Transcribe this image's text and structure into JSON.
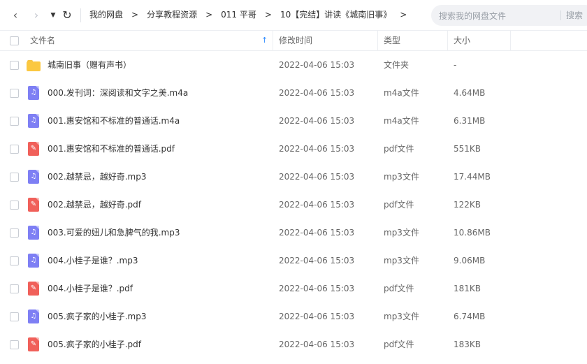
{
  "toolbar": {
    "back_glyph": "‹",
    "forward_glyph": "›",
    "dropdown_glyph": "▼",
    "refresh_glyph": "↻"
  },
  "breadcrumbs": [
    "我的网盘",
    "分享教程资源",
    "011 平哥",
    "10【完结】讲读《城南旧事》"
  ],
  "breadcrumb_sep": ">",
  "search": {
    "placeholder": "搜索我的网盘文件",
    "button": "搜索"
  },
  "columns": {
    "name": "文件名",
    "modified": "修改时间",
    "type": "类型",
    "size": "大小",
    "sort_glyph": "↑"
  },
  "icons": {
    "folder": "folder-icon",
    "audio": "audio-file-icon",
    "pdf": "pdf-file-icon"
  },
  "files": [
    {
      "icon": "folder",
      "name": "城南旧事（赠有声书）",
      "modified": "2022-04-06 15:03",
      "type": "文件夹",
      "size": "-"
    },
    {
      "icon": "audio",
      "name": "000.发刊词：深阅读和文字之美.m4a",
      "modified": "2022-04-06 15:03",
      "type": "m4a文件",
      "size": "4.64MB"
    },
    {
      "icon": "audio",
      "name": "001.惠安馆和不标准的普通话.m4a",
      "modified": "2022-04-06 15:03",
      "type": "m4a文件",
      "size": "6.31MB"
    },
    {
      "icon": "pdf",
      "name": "001.惠安馆和不标准的普通话.pdf",
      "modified": "2022-04-06 15:03",
      "type": "pdf文件",
      "size": "551KB"
    },
    {
      "icon": "audio",
      "name": "002.越禁忌，越好奇.mp3",
      "modified": "2022-04-06 15:03",
      "type": "mp3文件",
      "size": "17.44MB"
    },
    {
      "icon": "pdf",
      "name": "002.越禁忌，越好奇.pdf",
      "modified": "2022-04-06 15:03",
      "type": "pdf文件",
      "size": "122KB"
    },
    {
      "icon": "audio",
      "name": "003.可爱的妞儿和急脾气的我.mp3",
      "modified": "2022-04-06 15:03",
      "type": "mp3文件",
      "size": "10.86MB"
    },
    {
      "icon": "audio",
      "name": "004.小桂子是谁？.mp3",
      "modified": "2022-04-06 15:03",
      "type": "mp3文件",
      "size": "9.06MB"
    },
    {
      "icon": "pdf",
      "name": "004.小桂子是谁？.pdf",
      "modified": "2022-04-06 15:03",
      "type": "pdf文件",
      "size": "181KB"
    },
    {
      "icon": "audio",
      "name": "005.疯子家的小桂子.mp3",
      "modified": "2022-04-06 15:03",
      "type": "mp3文件",
      "size": "6.74MB"
    },
    {
      "icon": "pdf",
      "name": "005.疯子家的小桂子.pdf",
      "modified": "2022-04-06 15:03",
      "type": "pdf文件",
      "size": "183KB"
    }
  ]
}
